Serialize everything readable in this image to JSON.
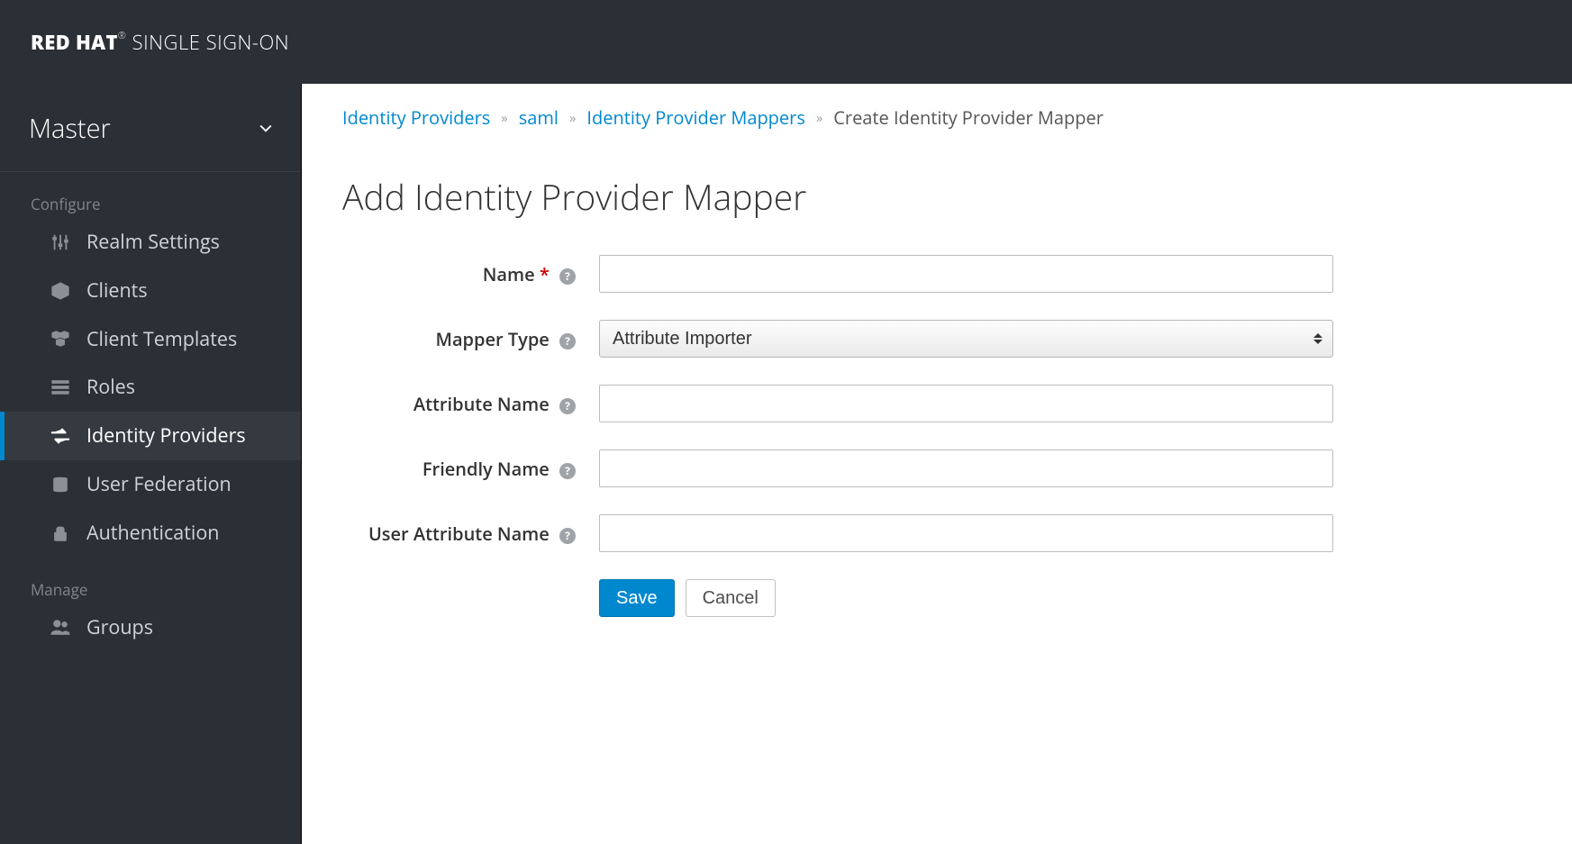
{
  "header": {
    "brand_bold": "RED HAT",
    "brand_thin": "SINGLE SIGN-ON"
  },
  "sidebar": {
    "realm": "Master",
    "sections": [
      {
        "label": "Configure",
        "items": [
          {
            "icon": "sliders-icon",
            "label": "Realm Settings"
          },
          {
            "icon": "cube-icon",
            "label": "Clients"
          },
          {
            "icon": "cubes-icon",
            "label": "Client Templates"
          },
          {
            "icon": "list-icon",
            "label": "Roles"
          },
          {
            "icon": "exchange-icon",
            "label": "Identity Providers",
            "active": true
          },
          {
            "icon": "database-icon",
            "label": "User Federation"
          },
          {
            "icon": "lock-icon",
            "label": "Authentication"
          }
        ]
      },
      {
        "label": "Manage",
        "items": [
          {
            "icon": "group-icon",
            "label": "Groups"
          }
        ]
      }
    ]
  },
  "breadcrumbs": {
    "items": [
      {
        "label": "Identity Providers",
        "link": true
      },
      {
        "label": "saml",
        "link": true
      },
      {
        "label": "Identity Provider Mappers",
        "link": true
      },
      {
        "label": "Create Identity Provider Mapper",
        "link": false
      }
    ]
  },
  "page": {
    "title": "Add Identity Provider Mapper"
  },
  "form": {
    "name": {
      "label": "Name",
      "required": true,
      "value": ""
    },
    "mapper_type": {
      "label": "Mapper Type",
      "value": "Attribute Importer",
      "options": [
        "Attribute Importer"
      ]
    },
    "attribute_name": {
      "label": "Attribute Name",
      "value": ""
    },
    "friendly_name": {
      "label": "Friendly Name",
      "value": ""
    },
    "user_attribute_name": {
      "label": "User Attribute Name",
      "value": ""
    },
    "save": "Save",
    "cancel": "Cancel"
  }
}
